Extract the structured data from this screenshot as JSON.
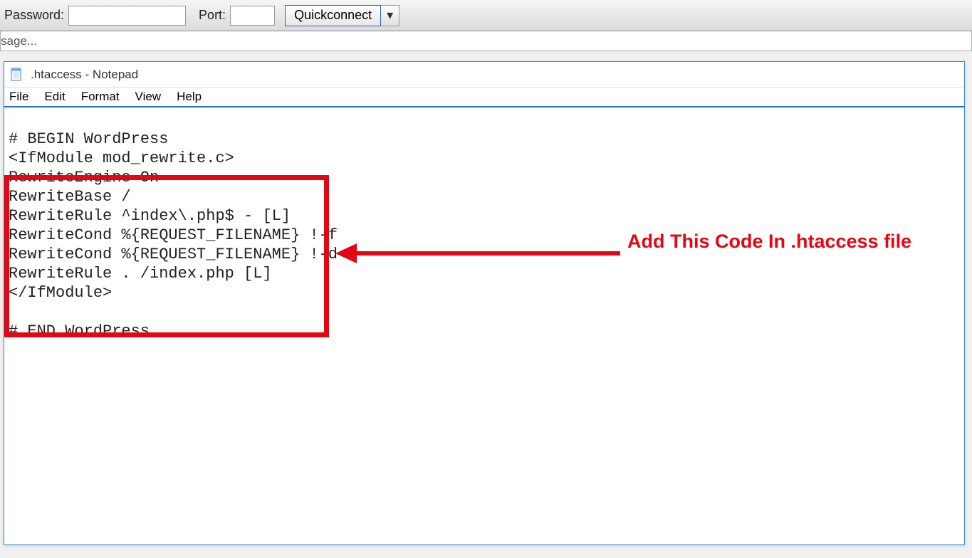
{
  "toolbar": {
    "password_label": "Password:",
    "port_label": "Port:",
    "quickconnect_label": "Quickconnect"
  },
  "status": {
    "text": "sage..."
  },
  "notepad": {
    "title": ".htaccess - Notepad",
    "menu": {
      "file": "File",
      "edit": "Edit",
      "format": "Format",
      "view": "View",
      "help": "Help"
    },
    "content": {
      "line1": "# BEGIN WordPress",
      "line2": "<IfModule mod_rewrite.c>",
      "line3": "RewriteEngine On",
      "line4": "RewriteBase /",
      "line5": "RewriteRule ^index\\.php$ - [L]",
      "line6": "RewriteCond %{REQUEST_FILENAME} !-f",
      "line7": "RewriteCond %{REQUEST_FILENAME} !-d",
      "line8": "RewriteRule . /index.php [L]",
      "line9": "</IfModule>",
      "line10": "",
      "line11": "# END WordPress"
    }
  },
  "annotation": {
    "text": "Add This Code In .htaccess file"
  }
}
